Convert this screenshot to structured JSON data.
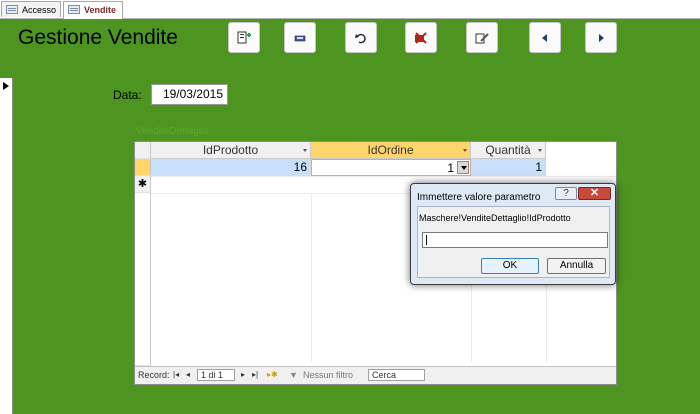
{
  "tabs": [
    {
      "label": "Accesso"
    },
    {
      "label": "Vendite"
    }
  ],
  "form": {
    "title": "Gestione Vendite",
    "data_label": "Data:",
    "data_value": "19/03/2015",
    "subform_caption": "VenditeDettaglio"
  },
  "toolbar": {
    "buttons": [
      {
        "icon": "new-record-icon"
      },
      {
        "icon": "save-icon"
      },
      {
        "icon": "undo-icon"
      },
      {
        "icon": "delete-record-icon"
      },
      {
        "icon": "edit-icon"
      },
      {
        "icon": "previous-record-icon"
      },
      {
        "icon": "next-record-icon"
      }
    ]
  },
  "grid": {
    "columns": [
      "IdProdotto",
      "IdOrdine",
      "Quantità"
    ],
    "rows": [
      {
        "IdProdotto": "16",
        "IdOrdine": "1",
        "Quantità": "1"
      }
    ],
    "new_row_marker": "✱"
  },
  "navbar": {
    "record_label": "Record:",
    "record_position": "1 di 1",
    "filter_label": "Nessun filtro",
    "search_placeholder": "Cerca"
  },
  "dialog": {
    "title": "Immettere valore parametro",
    "help_label": "?",
    "close_label": "✕",
    "prompt": "Maschere!VenditeDettaglio!IdProdotto",
    "input_value": "",
    "ok_label": "OK",
    "cancel_label": "Annulla"
  },
  "colors": {
    "background": "#4d9420",
    "header_active": "#ffd56b",
    "row_selected": "#c7e0f8"
  }
}
